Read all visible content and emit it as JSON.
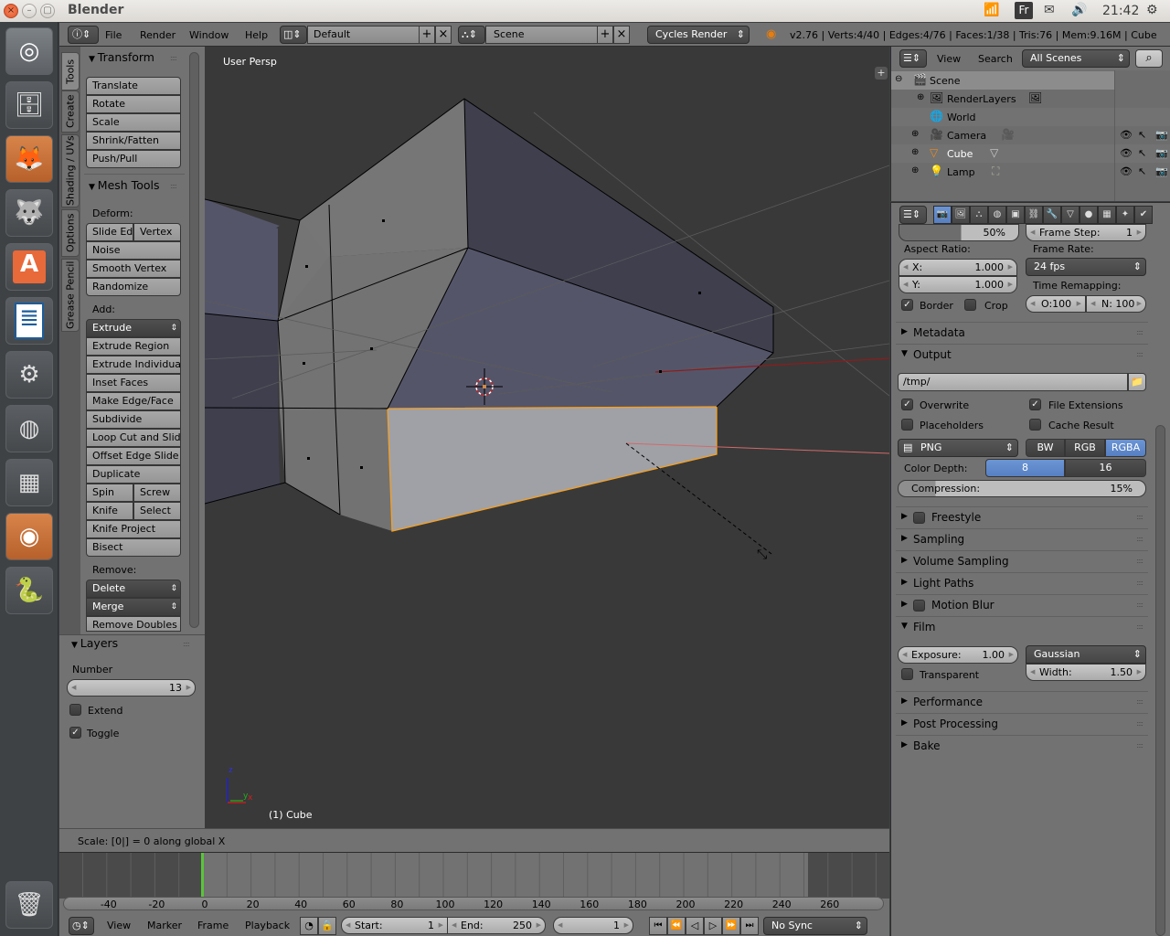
{
  "topbar": {
    "app_title": "Blender",
    "window_buttons": [
      "close",
      "minimize",
      "maximize"
    ],
    "tray": {
      "wifi_icon": "wifi",
      "keyboard_layout": "Fr",
      "mail_icon": "mail",
      "volume_icon": "volume",
      "time": "21:42",
      "power_icon": "gear-power"
    }
  },
  "launcher": {
    "items": [
      {
        "name": "ubuntu-dash",
        "glyph": "◎"
      },
      {
        "name": "files",
        "glyph": "🗄"
      },
      {
        "name": "firefox",
        "glyph": "🦊"
      },
      {
        "name": "gimp",
        "glyph": "🐺"
      },
      {
        "name": "software-center",
        "glyph": "A"
      },
      {
        "name": "libreoffice-writer",
        "glyph": "≣"
      },
      {
        "name": "system-settings",
        "glyph": "⚙"
      },
      {
        "name": "disk",
        "glyph": "◍"
      },
      {
        "name": "calculator",
        "glyph": "▦"
      },
      {
        "name": "blender",
        "glyph": "◉"
      },
      {
        "name": "python",
        "glyph": "🐍"
      }
    ],
    "trash_glyph": "🗑"
  },
  "infobar": {
    "menus": [
      "File",
      "Render",
      "Window",
      "Help"
    ],
    "screen_layout": "Default",
    "scene": "Scene",
    "render_engine": "Cycles Render",
    "stats": "v2.76 | Verts:4/40 | Edges:4/76 | Faces:1/38 | Tris:76 | Mem:9.16M | Cube"
  },
  "tool_tabs": [
    "Tools",
    "Create",
    "Shading / UVs",
    "Options",
    "Grease Pencil"
  ],
  "toolshelf": {
    "transform": {
      "title": "Transform",
      "buttons": [
        "Translate",
        "Rotate",
        "Scale",
        "Shrink/Fatten",
        "Push/Pull"
      ]
    },
    "mesh_tools": {
      "title": "Mesh Tools",
      "deform_label": "Deform:",
      "slide_edge": "Slide Ed",
      "vertex": "Vertex",
      "deform_buttons": [
        "Noise",
        "Smooth Vertex",
        "Randomize"
      ],
      "add_label": "Add:",
      "extrude": "Extrude",
      "add_buttons": [
        "Extrude Region",
        "Extrude Individual",
        "Inset Faces",
        "Make Edge/Face",
        "Subdivide",
        "Loop Cut and Slide",
        "Offset Edge Slide",
        "Duplicate"
      ],
      "spin": "Spin",
      "screw": "Screw",
      "knife": "Knife",
      "select": "Select",
      "more_buttons": [
        "Knife Project",
        "Bisect"
      ],
      "remove_label": "Remove:",
      "delete": "Delete",
      "merge": "Merge",
      "remove_doubles": "Remove Doubles"
    }
  },
  "layers_panel": {
    "title": "Layers",
    "number_label": "Number",
    "number_value": "13",
    "extend_label": "Extend",
    "extend_checked": false,
    "toggle_label": "Toggle",
    "toggle_checked": true
  },
  "viewport": {
    "view_label": "User Persp",
    "object_label": "(1) Cube",
    "axis_labels": {
      "z": "z",
      "y": "y",
      "x": "x"
    }
  },
  "status": {
    "operator_text": "Scale: [0|] = 0 along global X"
  },
  "timeline": {
    "ticks": [
      "-40",
      "-20",
      "0",
      "20",
      "40",
      "60",
      "80",
      "100",
      "120",
      "140",
      "160",
      "180",
      "200",
      "220",
      "240",
      "260"
    ],
    "menus": [
      "View",
      "Marker",
      "Frame",
      "Playback"
    ],
    "start_label": "Start:",
    "start_value": "1",
    "end_label": "End:",
    "end_value": "250",
    "current_frame": "1",
    "sync": "No Sync",
    "playback_glyphs": [
      "⏮",
      "⏪",
      "◁",
      "▷",
      "⏩",
      "⏭"
    ]
  },
  "outliner": {
    "menus": [
      "View",
      "Search"
    ],
    "filter": "All Scenes",
    "rows": [
      {
        "label": "Scene",
        "icon": "🎬"
      },
      {
        "label": "RenderLayers",
        "icon": "🖼"
      },
      {
        "label": "World",
        "icon": "🌐"
      },
      {
        "label": "Camera",
        "icon": "🎥"
      },
      {
        "label": "Cube",
        "icon": "▽"
      },
      {
        "label": "Lamp",
        "icon": "💡"
      }
    ]
  },
  "properties": {
    "tab_icons": [
      "render",
      "render-layers",
      "scene",
      "world",
      "object",
      "constraints",
      "modifiers",
      "data",
      "material",
      "texture",
      "particles",
      "physics"
    ],
    "resolution_pct": "50%",
    "frame_step_label": "Frame Step:",
    "frame_step_value": "1",
    "aspect_ratio_label": "Aspect Ratio:",
    "aspect_x_label": "X:",
    "aspect_x_value": "1.000",
    "aspect_y_label": "Y:",
    "aspect_y_value": "1.000",
    "frame_rate_label": "Frame Rate:",
    "frame_rate_value": "24 fps",
    "time_remap_label": "Time Remapping:",
    "time_old": "O:100",
    "time_new": "N: 100",
    "border_label": "Border",
    "border_checked": true,
    "crop_label": "Crop",
    "crop_checked": false,
    "metadata": "Metadata",
    "output": {
      "title": "Output",
      "path": "/tmp/",
      "overwrite": "Overwrite",
      "file_extensions": "File Extensions",
      "placeholders": "Placeholders",
      "cache_result": "Cache Result",
      "format": "PNG",
      "color_modes": [
        "BW",
        "RGB",
        "RGBA"
      ],
      "color_mode_selected": "RGBA",
      "color_depth_label": "Color Depth:",
      "color_depths": [
        "8",
        "16"
      ],
      "color_depth_selected": "8",
      "compression_label": "Compression:",
      "compression_value": "15%",
      "compression_fraction": 0.15
    },
    "collapsed_sections": [
      "Freestyle",
      "Sampling",
      "Volume Sampling",
      "Light Paths",
      "Motion Blur"
    ],
    "film": {
      "title": "Film",
      "exposure_label": "Exposure:",
      "exposure_value": "1.00",
      "filter": "Gaussian",
      "width_label": "Width:",
      "width_value": "1.50",
      "transparent_label": "Transparent"
    },
    "bottom_sections": [
      "Performance",
      "Post Processing",
      "Bake"
    ]
  }
}
